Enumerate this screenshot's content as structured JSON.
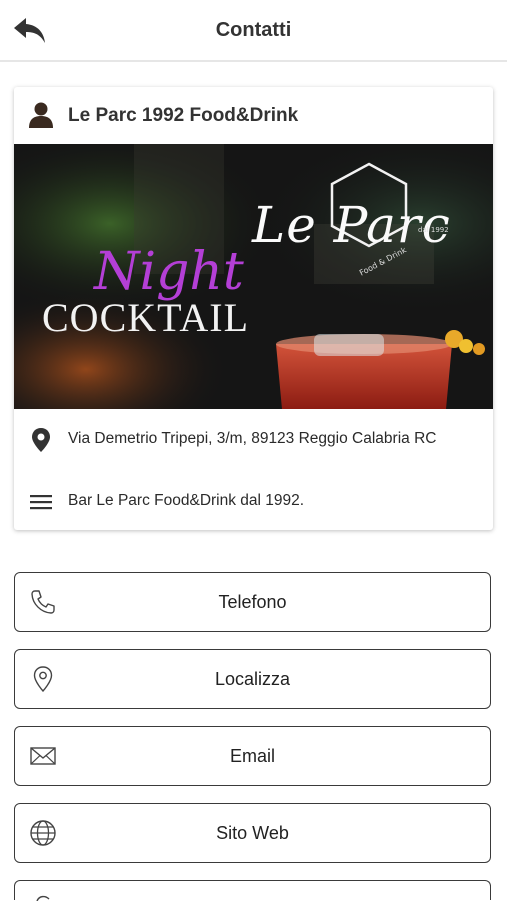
{
  "header": {
    "title": "Contatti",
    "back_icon": "back-arrow-icon"
  },
  "card": {
    "title": "Le Parc 1992 Food&Drink",
    "banner": {
      "logo_text": "Le Parc",
      "logo_sub": "Food & Drink",
      "logo_est": "dal 1992",
      "night": "Night",
      "cocktail": "COCKTAIL"
    },
    "address": "Via Demetrio Tripepi, 3/m, 89123 Reggio Calabria RC",
    "description": "Bar Le Parc Food&Drink dal 1992."
  },
  "buttons": [
    {
      "label": "Telefono",
      "icon": "phone-icon"
    },
    {
      "label": "Localizza",
      "icon": "location-pin-icon"
    },
    {
      "label": "Email",
      "icon": "envelope-icon"
    },
    {
      "label": "Sito Web",
      "icon": "globe-icon"
    },
    {
      "label": "",
      "icon": "partial-icon"
    }
  ],
  "colors": {
    "night_text": "#b43fd6",
    "border": "#3a3a3a",
    "divider": "#e6e6e6"
  }
}
